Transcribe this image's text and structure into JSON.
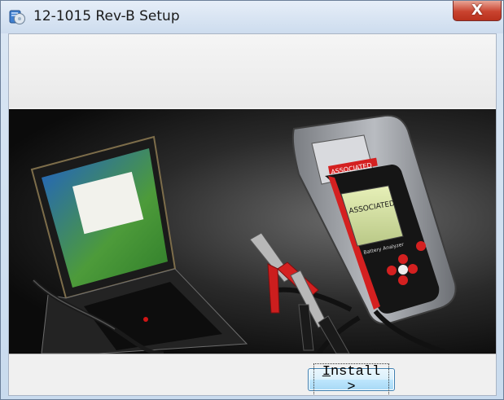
{
  "window": {
    "title": "12-1015 Rev-B Setup",
    "close_label": "X"
  },
  "banner": {
    "image": "laptop-and-battery-analyzer-photo",
    "device_brand": "ASSOCIATED",
    "screen_text": "ASSOCIATED",
    "device_label": "Battery Analyzer"
  },
  "footer": {
    "install_mnemonic": "I",
    "install_rest": "nstall >"
  },
  "colors": {
    "title_bar": "#cddcee",
    "close_button": "#c9432f",
    "install_button": "#bee6fd",
    "device_accent": "#d42020"
  }
}
